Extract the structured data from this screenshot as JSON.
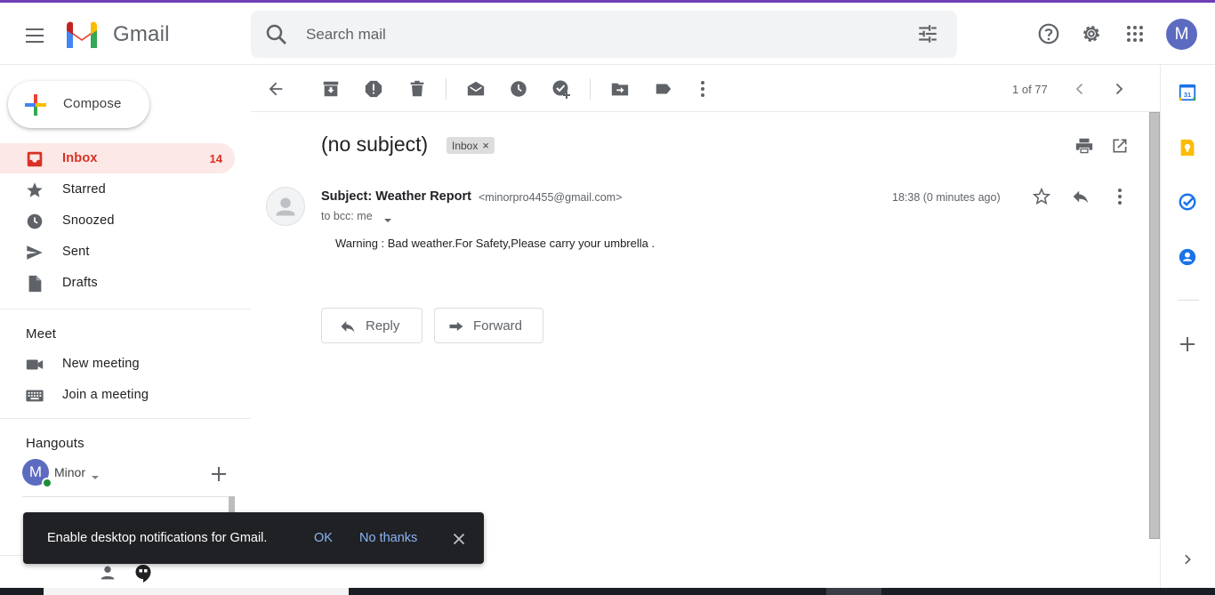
{
  "app": {
    "name": "Gmail"
  },
  "colors": {
    "accent": "#d93025",
    "link": "#8ab4f8",
    "avatar": "#5c6bc0",
    "topline": "#6f3fb5"
  },
  "header": {
    "search_placeholder": "Search mail",
    "avatar_letter": "M",
    "icons": [
      "menu-icon",
      "search-icon",
      "tune-icon",
      "help-icon",
      "settings-icon",
      "apps-icon"
    ]
  },
  "sidebar": {
    "compose_label": "Compose",
    "items": [
      {
        "label": "Inbox",
        "count": "14",
        "icon": "inbox-icon",
        "active": true
      },
      {
        "label": "Starred",
        "icon": "star-icon"
      },
      {
        "label": "Snoozed",
        "icon": "clock-icon"
      },
      {
        "label": "Sent",
        "icon": "send-icon"
      },
      {
        "label": "Drafts",
        "icon": "draft-icon"
      }
    ],
    "meet": {
      "title": "Meet",
      "items": [
        {
          "label": "New meeting",
          "icon": "video-icon"
        },
        {
          "label": "Join a meeting",
          "icon": "keyboard-icon"
        }
      ]
    },
    "hangouts": {
      "title": "Hangouts",
      "user_letter": "M",
      "user_name": "Minor"
    }
  },
  "toolbar": {
    "pager": "1 of 77"
  },
  "message": {
    "subject": "(no subject)",
    "label": "Inbox",
    "label_close": "×",
    "from_name": "Subject: Weather Report",
    "from_email": "<minorpro4455@gmail.com>",
    "to": "to bcc: me",
    "time": "18:38 (0 minutes ago)",
    "body": "Warning : Bad weather.For Safety,Please carry your umbrella  .",
    "reply_label": "Reply",
    "forward_label": "Forward"
  },
  "toast": {
    "message": "Enable desktop notifications for Gmail.",
    "ok": "OK",
    "no_thanks": "No thanks"
  },
  "side_panel": {
    "icons": [
      "calendar-icon",
      "keep-icon",
      "tasks-icon",
      "contacts-icon",
      "add-icon",
      "chevron-right-icon"
    ]
  }
}
